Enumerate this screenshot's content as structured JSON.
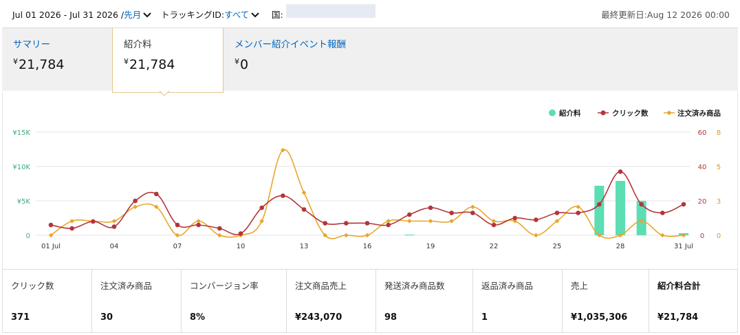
{
  "header": {
    "date_range": "Jul 01 2026 - Jul 31 2026 /",
    "period_link": "先月",
    "tracking_label": "トラッキングID:",
    "tracking_value": "すべて",
    "country_label": "国:",
    "last_updated": "最終更新日:Aug 12 2026 00:00"
  },
  "tabs": [
    {
      "label": "サマリー",
      "currency": "¥",
      "value": "21,784"
    },
    {
      "label": "紹介料",
      "currency": "¥",
      "value": "21,784"
    },
    {
      "label": "メンバー紹介イベント報酬",
      "currency": "¥",
      "value": "0"
    }
  ],
  "colors": {
    "fee": "#5dddb4",
    "clicks": "#b3353a",
    "ordered": "#e8a62a",
    "left_axis": "#3aaa7a",
    "mid_axis": "#b3353a",
    "right_axis": "#d69a1f",
    "grid": "#e3e3e3"
  },
  "chart_data": {
    "type": "bar+line",
    "legend": [
      "紹介料",
      "クリック数",
      "注文済み商品"
    ],
    "legend_placement": "top-right",
    "x_ticks": [
      "01 Jul",
      "04",
      "07",
      "10",
      "13",
      "16",
      "19",
      "22",
      "25",
      "28",
      "31 Jul"
    ],
    "left_axis": {
      "ticks": [
        "0",
        "¥5K",
        "¥10K",
        "¥15K"
      ],
      "range": [
        0,
        15000
      ]
    },
    "clicks_axis": {
      "ticks": [
        "0",
        "20",
        "40",
        "60"
      ],
      "range": [
        0,
        60
      ]
    },
    "ordered_axis": {
      "ticks": [
        "0",
        "3",
        "5",
        "8"
      ],
      "range": [
        0,
        8
      ]
    },
    "days": [
      1,
      2,
      3,
      4,
      5,
      6,
      7,
      8,
      9,
      10,
      11,
      12,
      13,
      14,
      15,
      16,
      17,
      18,
      19,
      20,
      21,
      22,
      23,
      24,
      25,
      26,
      27,
      28,
      29,
      30,
      31
    ],
    "series": [
      {
        "name": "紹介料",
        "kind": "bar",
        "values": [
          0,
          0,
          0,
          0,
          0,
          0,
          0,
          0,
          0,
          0,
          0,
          0,
          0,
          0,
          0,
          0,
          0,
          100,
          0,
          0,
          0,
          0,
          0,
          0,
          0,
          0,
          7200,
          7900,
          5000,
          0,
          300
        ]
      },
      {
        "name": "クリック数",
        "kind": "line",
        "values": [
          6,
          4,
          8,
          5,
          20,
          24,
          6,
          6,
          4,
          1,
          16,
          23,
          15,
          7,
          7,
          7,
          6,
          12,
          16,
          13,
          13,
          6,
          10,
          9,
          13,
          13,
          18,
          37,
          18,
          13,
          18
        ]
      },
      {
        "name": "注文済み商品",
        "kind": "line",
        "values": [
          0,
          1.1,
          1.1,
          1.1,
          2.2,
          2.2,
          0,
          1.1,
          0,
          0,
          1.1,
          6.6,
          3.3,
          0,
          0,
          0,
          1.1,
          1.1,
          1.1,
          1.1,
          2.2,
          1.1,
          1.1,
          0,
          1.1,
          2.2,
          0,
          0,
          1.1,
          0,
          0
        ]
      }
    ]
  },
  "stats": [
    {
      "label": "クリック数",
      "value": "371"
    },
    {
      "label": "注文済み商品",
      "value": "30"
    },
    {
      "label": "コンバージョン率",
      "value": "8%"
    },
    {
      "label": "注文商品売上",
      "value": "¥243,070"
    },
    {
      "label": "発送済み商品数",
      "value": "98"
    },
    {
      "label": "返品済み商品",
      "value": "1"
    },
    {
      "label": "売上",
      "value": "¥1,035,306"
    },
    {
      "label": "紹介料合計",
      "value": "¥21,784"
    }
  ]
}
